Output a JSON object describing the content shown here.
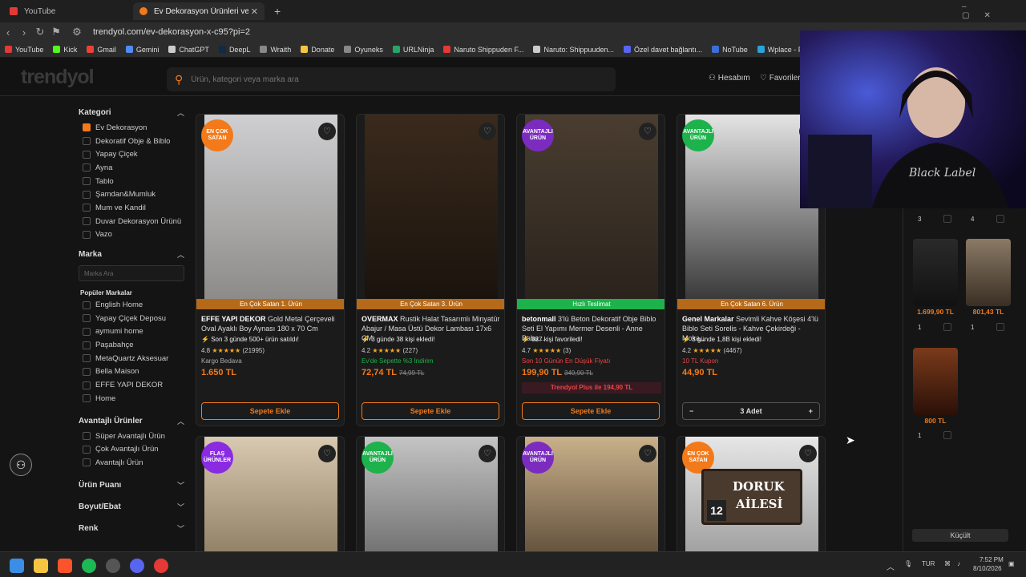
{
  "browser": {
    "tabs": [
      {
        "title": "YouTube",
        "color": "#e53935"
      },
      {
        "title": "Ev Dekorasyon Ürünleri ve Süs E",
        "color": "#f27a1a"
      }
    ],
    "url": "trendyol.com/ev-dekorasyon-x-c95?pi=2",
    "bookmarks": [
      {
        "label": "YouTube",
        "color": "#e53935"
      },
      {
        "label": "Kick",
        "color": "#53fc18"
      },
      {
        "label": "Gmail",
        "color": "#ea4335"
      },
      {
        "label": "Gemini",
        "color": "#4f8cf7"
      },
      {
        "label": "ChatGPT",
        "color": "#cccccc"
      },
      {
        "label": "DeepL",
        "color": "#0f2b46"
      },
      {
        "label": "Wraith",
        "color": "#888888"
      },
      {
        "label": "Donate",
        "color": "#f5c542"
      },
      {
        "label": "Oyuneks",
        "color": "#888888"
      },
      {
        "label": "URLNinja",
        "color": "#2aa36b"
      },
      {
        "label": "Naruto Shippuden F...",
        "color": "#e53935"
      },
      {
        "label": "Naruto: Shippuuden...",
        "color": "#cccccc"
      },
      {
        "label": "Özel davet bağlantı...",
        "color": "#5865f2"
      },
      {
        "label": "NoTube",
        "color": "#3b6fd8"
      },
      {
        "label": "Wplace - Paint the...",
        "color": "#2aa3d8"
      }
    ]
  },
  "site": {
    "logo": "trendyol",
    "search_placeholder": "Ürün, kategori veya marka ara",
    "account": "Hesabım",
    "favorites": "Favoriler"
  },
  "sidebar": {
    "kategori_title": "Kategori",
    "categories": [
      {
        "label": "Ev Dekorasyon",
        "checked": true
      },
      {
        "label": "Dekoratif Obje & Biblo"
      },
      {
        "label": "Yapay Çiçek"
      },
      {
        "label": "Ayna"
      },
      {
        "label": "Tablo"
      },
      {
        "label": "Şamdan&Mumluk"
      },
      {
        "label": "Mum ve Kandil"
      },
      {
        "label": "Duvar Dekorasyon Ürünü"
      },
      {
        "label": "Vazo"
      }
    ],
    "marka_title": "Marka",
    "marka_search": "Marka Ara",
    "popular_title": "Popüler Markalar",
    "brands": [
      "English Home",
      "Yapay Çiçek Deposu",
      "aymumi home",
      "Paşabahçe",
      "MetaQuartz Aksesuar",
      "Bella Maison",
      "EFFE YAPI DEKOR",
      "Home"
    ],
    "avantaj_title": "Avantajlı Ürünler",
    "avantaj": [
      "Süper Avantajlı Ürün",
      "Çok Avantajlı Ürün",
      "Avantajlı Ürün"
    ],
    "puan_title": "Ürün Puanı",
    "boyut_title": "Boyut/Ebat",
    "renk_title": "Renk"
  },
  "products": [
    {
      "badge": "EN ÇOK SATAN",
      "badge_color": "#f27a1a",
      "strip": "En Çok Satan 1. Ürün",
      "brand": "EFFE YAPI DEKOR",
      "name": "Gold Metal Çerçeveli Oval Ayaklı Boy Aynası 180 x 70 Cm",
      "social": "Son 3 günde 500+ ürün satıldı!",
      "rating": "4.8",
      "stars": "★★★★★",
      "reviews": "(21995)",
      "extra": "Kargo Bedava",
      "price": "1.650 TL",
      "old_price": "",
      "button": "Sepete Ekle",
      "img_colors": [
        "#cfcfd2",
        "#8d8b88"
      ]
    },
    {
      "badge": "",
      "badge_color": "",
      "strip": "En Çok Satan 3. Ürün",
      "brand": "OVERMAX",
      "name": "Rustik Halat Tasarımlı Minyatür Abajur / Masa Üstü Dekor Lambası 17x6 CM",
      "social": "3 günde 38 kişi ekledi!",
      "rating": "4.2",
      "stars": "★★★★★",
      "reviews": "(227)",
      "extra": "Ev'de Sepette %3 İndirim",
      "price": "72,74 TL",
      "old_price": "74,99 TL",
      "button": "Sepete Ekle",
      "img_colors": [
        "#3a2a1c",
        "#1a130d"
      ]
    },
    {
      "badge": "AVANTAJLI ÜRÜN",
      "badge_color": "#7b2cbf",
      "strip": "Hızlı Teslimat",
      "brand": "betonmall",
      "name": "3'lü Beton Dekoratif Obje Biblo Seti El Yapımı Mermer Desenli - Anne Baba...",
      "social": "827 kişi favoriledi!",
      "rating": "4.7",
      "stars": "★★★★★",
      "reviews": "(3)",
      "extra": "Son 10 Günün En Düşük Fiyatı",
      "price": "199,90 TL",
      "old_price": "349,90 TL",
      "plus": "Trendyol Plus ile 194,90 TL",
      "button": "Sepete Ekle",
      "img_colors": [
        "#4a3d30",
        "#2a231c"
      ]
    },
    {
      "badge": "AVANTAJLI ÜRÜN",
      "badge_color": "#1db24b",
      "strip": "En Çok Satan 6. Ürün",
      "brand": "Genel Markalar",
      "name": "Sevimli Kahve Köşesi 4'lü Biblo Seti Sorelis - Kahve Çekirdeği - Moka...",
      "social": "3 günde 1,8B kişi ekledi!",
      "rating": "4.2",
      "stars": "★★★★★",
      "reviews": "(4467)",
      "extra": "10 TL Kupon",
      "price": "44,90 TL",
      "old_price": "",
      "button": "3 Adet",
      "img_colors": [
        "#e4e4e4",
        "#3a3a3a"
      ]
    }
  ],
  "row2_badges": [
    {
      "label": "FLAŞ ÜRÜNLER",
      "color": "#8a2be2"
    },
    {
      "label": "AVANTAJLI ÜRÜN",
      "color": "#1db24b"
    },
    {
      "label": "AVANTAJLI ÜRÜN",
      "color": "#7b2cbf"
    },
    {
      "label": "EN ÇOK SATAN",
      "color": "#f27a1a"
    }
  ],
  "sign_text": {
    "line1": "DORUK",
    "line2": "AİLESİ",
    "number": "12"
  },
  "side_panel": {
    "qty_top": [
      "3",
      "4"
    ],
    "items": [
      {
        "price": "1.699,90 TL",
        "qty": "1",
        "color": "#1c1c1c"
      },
      {
        "price": "801,43 TL",
        "qty": "1",
        "color": "#6a5a48"
      },
      {
        "price": "800 TL",
        "qty": "1",
        "color": "#5a2a1a"
      }
    ],
    "collapse": "Küçült"
  },
  "taskbar": {
    "lang": "TUR",
    "time": "7:52 PM",
    "date": "8/10/2026"
  }
}
